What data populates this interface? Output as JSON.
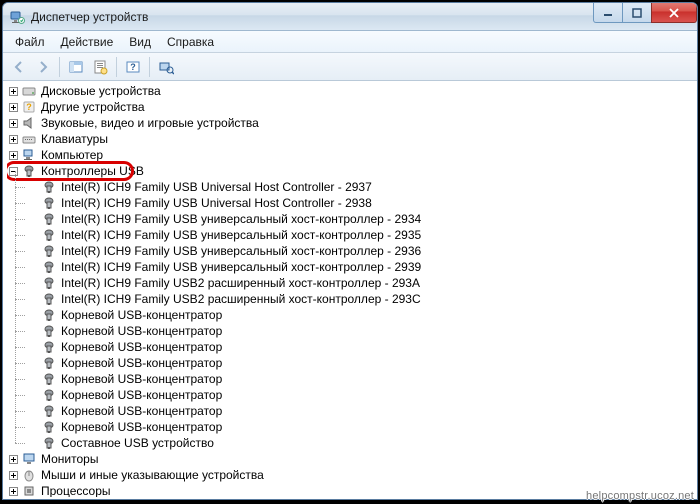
{
  "window": {
    "title": "Диспетчер устройств"
  },
  "menu": {
    "file": "Файл",
    "action": "Действие",
    "view": "Вид",
    "help": "Справка"
  },
  "toolbar_icons": {
    "back": "back-icon",
    "forward": "forward-icon",
    "console_root": "console-root-icon",
    "properties": "properties-icon",
    "help": "help-icon",
    "scan": "scan-hardware-icon"
  },
  "tree": {
    "root_nodes": [
      {
        "id": "disks",
        "icon": "drive",
        "label": "Дисковые устройства",
        "expandable": true
      },
      {
        "id": "other",
        "icon": "unknown",
        "label": "Другие устройства",
        "expandable": true
      },
      {
        "id": "sound",
        "icon": "speaker",
        "label": "Звуковые, видео и игровые устройства",
        "expandable": true
      },
      {
        "id": "keyboards",
        "icon": "keyboard",
        "label": "Клавиатуры",
        "expandable": true
      },
      {
        "id": "computer",
        "icon": "computer",
        "label": "Компьютер",
        "expandable": true
      },
      {
        "id": "usb",
        "icon": "usb",
        "label": "Контроллеры USB",
        "expandable": true,
        "expanded": true,
        "highlighted": true
      },
      {
        "id": "monitors",
        "icon": "monitor",
        "label": "Мониторы",
        "expandable": true
      },
      {
        "id": "mice",
        "icon": "mouse",
        "label": "Мыши и иные указывающие устройства",
        "expandable": true
      },
      {
        "id": "cpus",
        "icon": "cpu",
        "label": "Процессоры",
        "expandable": true
      }
    ],
    "usb_children": [
      "Intel(R) ICH9 Family USB Universal Host Controller - 2937",
      "Intel(R) ICH9 Family USB Universal Host Controller - 2938",
      "Intel(R) ICH9 Family USB универсальный хост-контроллер  - 2934",
      "Intel(R) ICH9 Family USB универсальный хост-контроллер  - 2935",
      "Intel(R) ICH9 Family USB универсальный хост-контроллер  - 2936",
      "Intel(R) ICH9 Family USB универсальный хост-контроллер  - 2939",
      "Intel(R) ICH9 Family USB2 расширенный хост-контроллер  - 293A",
      "Intel(R) ICH9 Family USB2 расширенный хост-контроллер  - 293C",
      "Корневой USB-концентратор",
      "Корневой USB-концентратор",
      "Корневой USB-концентратор",
      "Корневой USB-концентратор",
      "Корневой USB-концентратор",
      "Корневой USB-концентратор",
      "Корневой USB-концентратор",
      "Корневой USB-концентратор",
      "Составное USB устройство"
    ]
  },
  "watermark": "helpcompstr.ucoz.net"
}
